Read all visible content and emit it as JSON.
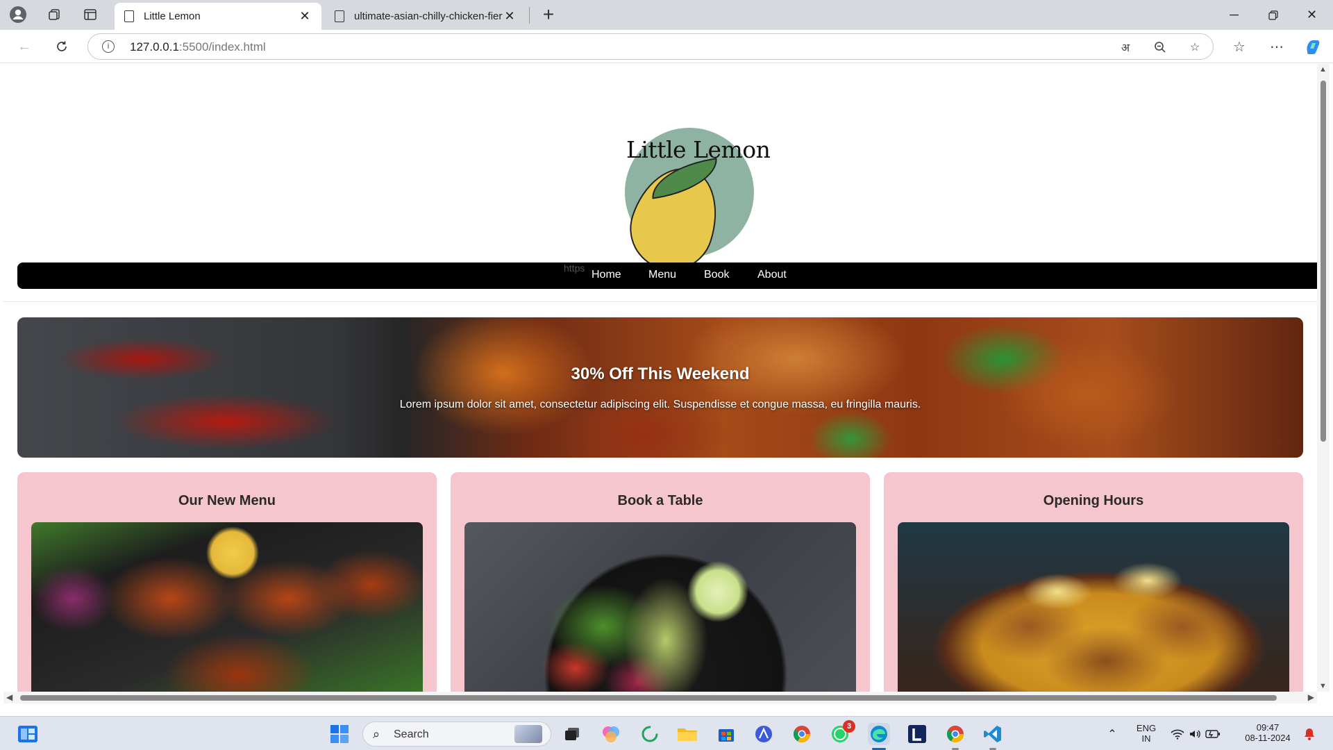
{
  "browser": {
    "tabs": [
      {
        "label": "Little Lemon",
        "active": true
      },
      {
        "label": "ultimate-asian-chilly-chicken-fiery",
        "active": false
      }
    ],
    "address": {
      "host": "127.0.0.1",
      "rest": ":5500/index.html"
    }
  },
  "page": {
    "logo_text": "Little Lemon",
    "broken_image_alt": "https",
    "nav": [
      "Home",
      "Menu",
      "Book",
      "About"
    ],
    "hero": {
      "title": "30% Off This Weekend",
      "text": "Lorem ipsum dolor sit amet, consectetur adipiscing elit. Suspendisse et congue massa, eu fringilla mauris."
    },
    "cards": [
      {
        "title": "Our New Menu"
      },
      {
        "title": "Book a Table"
      },
      {
        "title": "Opening Hours"
      }
    ]
  },
  "taskbar": {
    "search_label": "Search",
    "whatsapp_badge": "3",
    "lang": "ENG",
    "region": "IN",
    "time": "09:47",
    "date": "08-11-2024"
  },
  "colors": {
    "navbar": "#000000",
    "card_bg": "#f5c6cd",
    "logo_circle": "#8fb3a3",
    "lemon": "#e8c84a"
  }
}
